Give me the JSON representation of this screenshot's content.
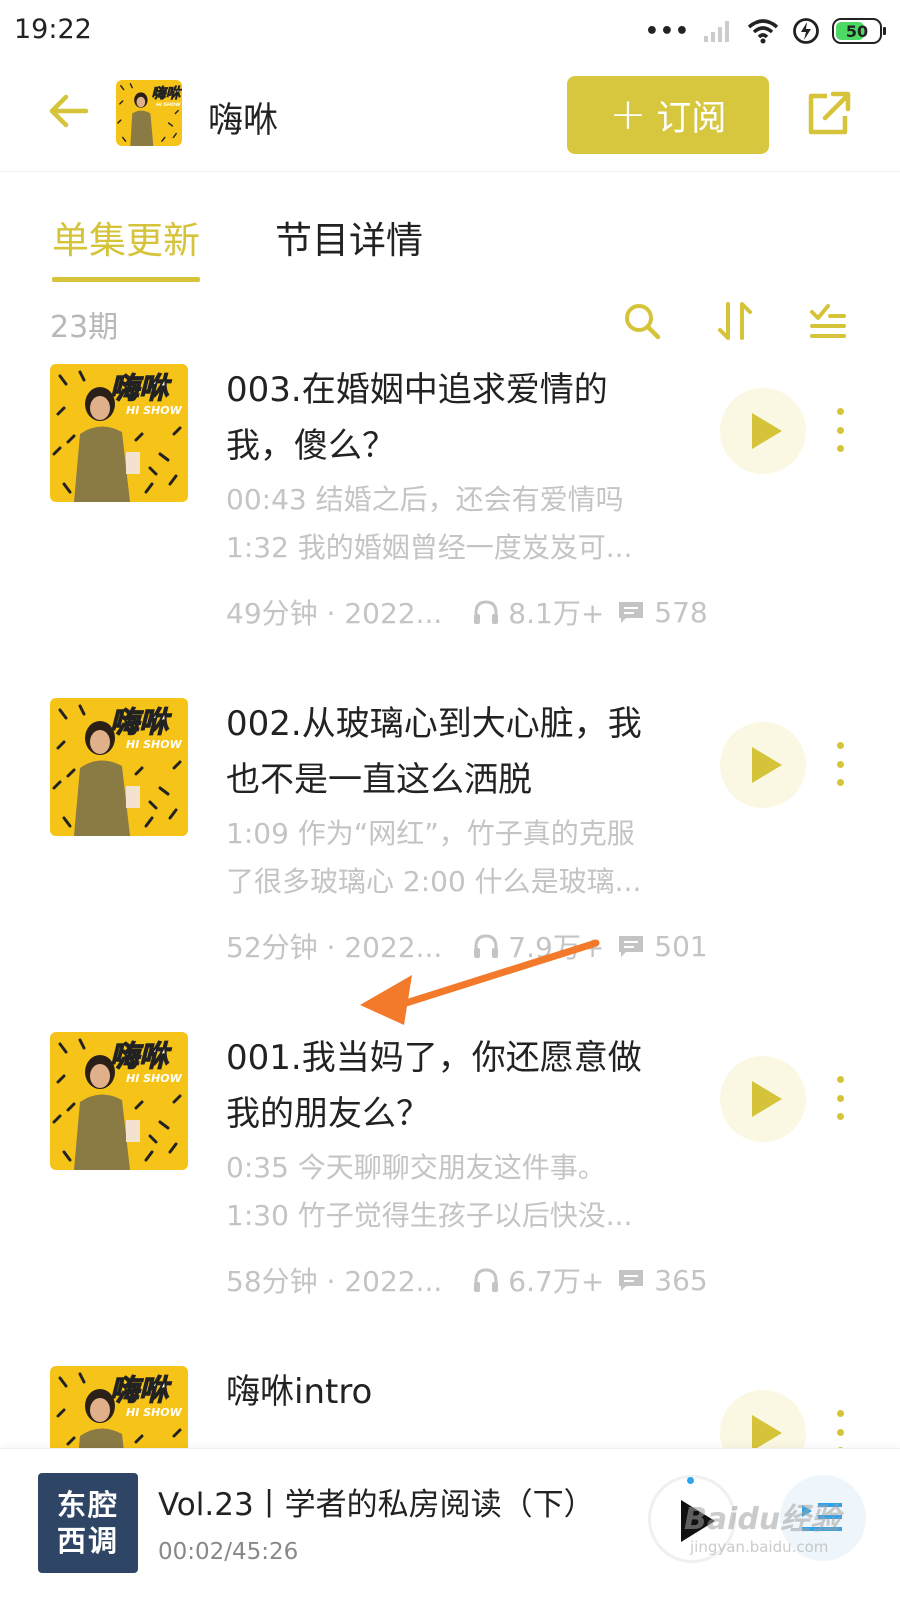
{
  "status_bar": {
    "time": "19:22",
    "battery": "50"
  },
  "header": {
    "title": "嗨咻",
    "subscribe_label": "订阅"
  },
  "tabs": [
    {
      "label": "单集更新",
      "active": true
    },
    {
      "label": "节目详情",
      "active": false
    }
  ],
  "list_info": {
    "episode_count": "23期"
  },
  "episodes": [
    {
      "title": "003.在婚姻中追求爱情的我，傻么？",
      "desc_line1": "00:43 结婚之后，还会有爱情吗",
      "desc_line2": "1:32 我的婚姻曾经一度岌岌可...",
      "meta_left": "49分钟 · 2022...",
      "plays": "8.1万+",
      "comments": "578"
    },
    {
      "title": "002.从玻璃心到大心脏，我也不是一直这么洒脱",
      "desc_line1": "1:09 作为“网红”，竹子真的克服",
      "desc_line2": "了很多玻璃心 2:00 什么是玻璃...",
      "meta_left": "52分钟 · 2022...",
      "plays": "7.9万+",
      "comments": "501"
    },
    {
      "title": "001.我当妈了，你还愿意做我的朋友么？",
      "desc_line1": "0:35 今天聊聊交朋友这件事。",
      "desc_line2": "1:30 竹子觉得生孩子以后快没...",
      "meta_left": "58分钟 · 2022...",
      "plays": "6.7万+",
      "comments": "365"
    },
    {
      "title": "嗨咻intro",
      "desc_line1": "",
      "desc_line2": "",
      "meta_left": "",
      "plays": "",
      "comments": ""
    }
  ],
  "cover": {
    "title": "嗨咻",
    "subtitle": "HI SHOW"
  },
  "player": {
    "cover_line1": "东腔",
    "cover_line2": "西调",
    "title": "Vol.23丨学者的私房阅读（下）",
    "time": "00:02/45:26"
  },
  "watermark": {
    "brand": "Baidu经验",
    "url": "jingyan.baidu.com"
  },
  "colors": {
    "accent": "#d5c43a",
    "subscribe_bg": "#d7c73f",
    "muted": "#c4c4c4",
    "annotation_arrow": "#f27a2a",
    "player_cover": "#2f4565"
  }
}
